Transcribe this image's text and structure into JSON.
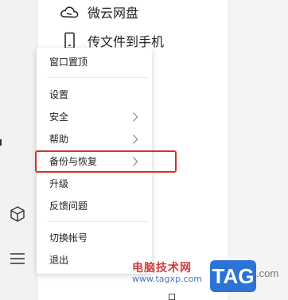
{
  "top_items": [
    {
      "label": "微云网盘",
      "icon": "cloud-icon"
    },
    {
      "label": "传文件到手机",
      "icon": "phone-icon"
    }
  ],
  "menu": {
    "items": [
      {
        "label": "窗口置顶"
      },
      {
        "label": "设置"
      },
      {
        "label": "安全",
        "submenu": true
      },
      {
        "label": "帮助",
        "submenu": true
      },
      {
        "label": "备份与恢复",
        "submenu": true,
        "highlighted": true
      },
      {
        "label": "升级"
      },
      {
        "label": "反馈问题"
      },
      {
        "label": "切换帐号"
      },
      {
        "label": "退出"
      }
    ]
  },
  "rail_icons": [
    "cube-icon",
    "hamburger-menu-icon"
  ],
  "highlight_color": "#d93025",
  "watermark": {
    "text": "电脑技术网",
    "url": "www.tagxp.com",
    "badge": "TAG",
    "suffix": ".com"
  }
}
